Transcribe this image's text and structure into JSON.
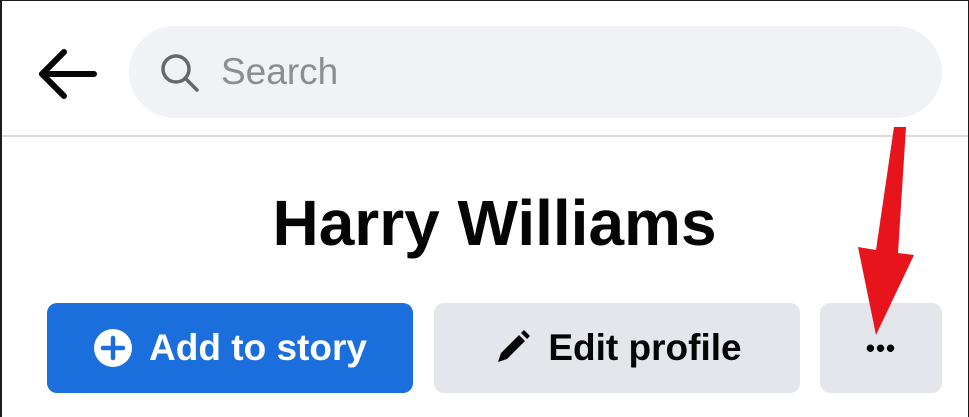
{
  "header": {
    "back_icon": "arrow-left-icon",
    "search": {
      "icon": "search-icon",
      "placeholder": "Search",
      "value": ""
    }
  },
  "profile": {
    "name": "Harry Williams"
  },
  "actions": {
    "add_to_story": {
      "label": "Add to story",
      "icon": "plus-circle-icon",
      "color": "#1b6fdc"
    },
    "edit_profile": {
      "label": "Edit profile",
      "icon": "pencil-icon"
    },
    "more": {
      "label": "•••",
      "icon": "more-dots-icon"
    }
  },
  "annotation": {
    "arrow_color": "#e8141b"
  }
}
